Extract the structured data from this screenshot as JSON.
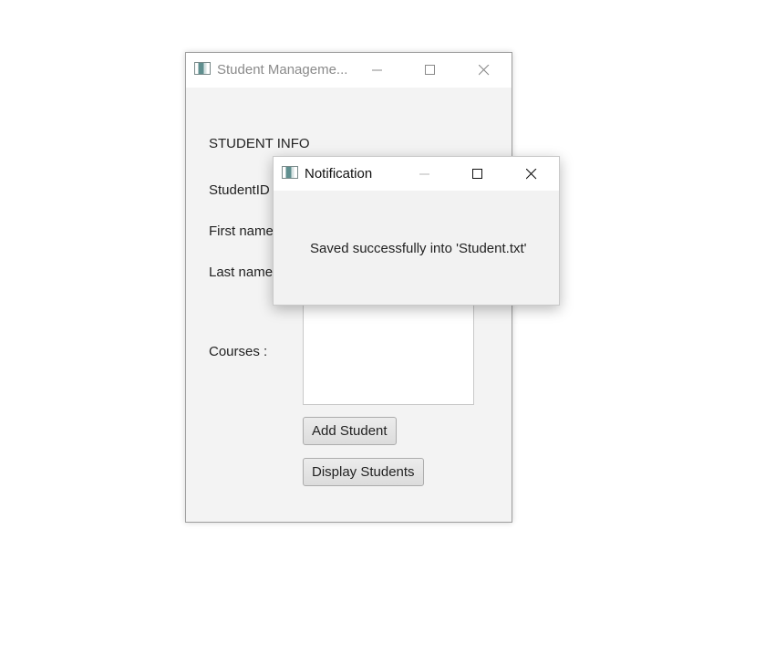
{
  "main_window": {
    "title": "Student Manageme...",
    "heading": "STUDENT INFO",
    "labels": {
      "student_id": "StudentID",
      "first_name": "First name",
      "last_name": "Last name",
      "courses": "Courses :"
    },
    "buttons": {
      "add_student": "Add Student",
      "display_students": "Display Students"
    }
  },
  "notification": {
    "title": "Notification",
    "message": "Saved successfully into 'Student.txt'"
  },
  "icons": {
    "app": "app-window-icon",
    "minimize": "minimize-icon",
    "maximize": "maximize-icon",
    "close": "close-icon"
  }
}
